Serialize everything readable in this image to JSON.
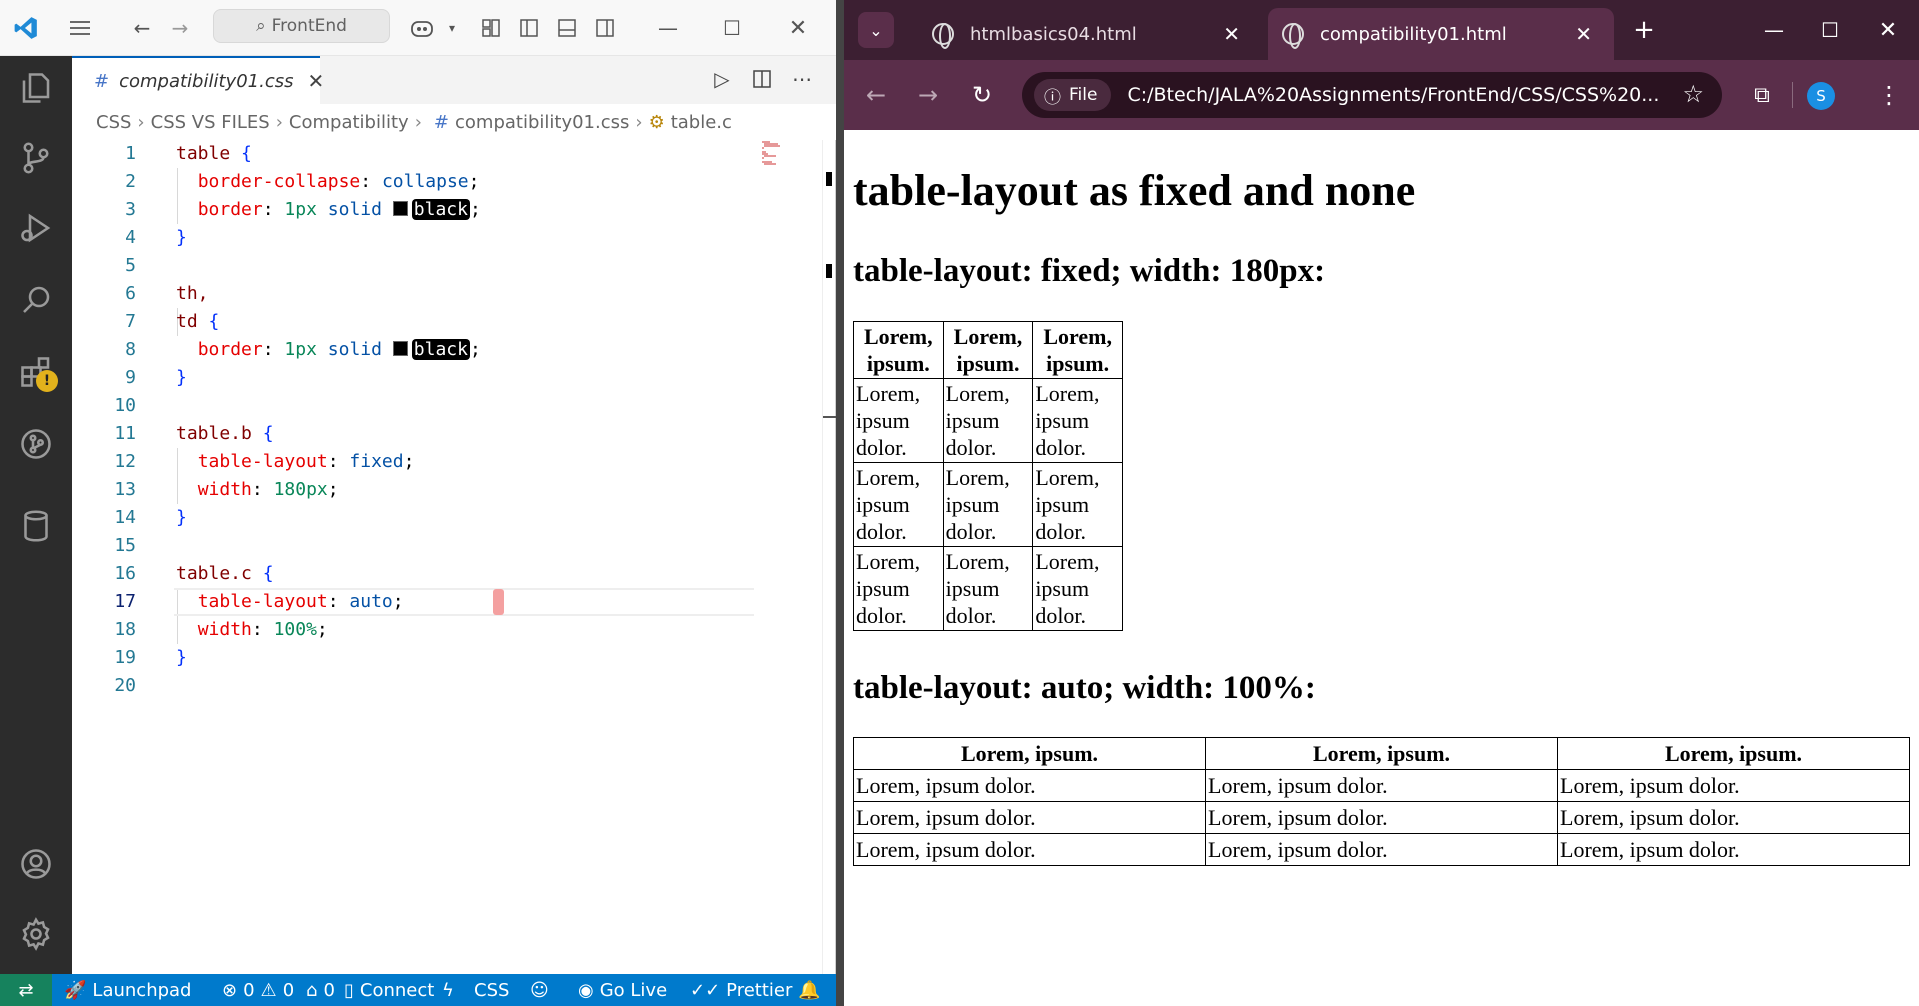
{
  "vscode": {
    "command_center": "FrontEnd",
    "tab": {
      "label": "compatibility01.css",
      "icon": "#"
    },
    "breadcrumb": [
      "CSS",
      "CSS VS FILES",
      "Compatibility",
      "compatibility01.css",
      "table.c"
    ],
    "breadcrumb_file_icon": "#",
    "code_lines": [
      {
        "n": "1"
      },
      {
        "n": "2"
      },
      {
        "n": "3"
      },
      {
        "n": "4"
      },
      {
        "n": "5"
      },
      {
        "n": "6"
      },
      {
        "n": "7"
      },
      {
        "n": "8"
      },
      {
        "n": "9"
      },
      {
        "n": "10"
      },
      {
        "n": "11"
      },
      {
        "n": "12"
      },
      {
        "n": "13"
      },
      {
        "n": "14"
      },
      {
        "n": "15"
      },
      {
        "n": "16"
      },
      {
        "n": "17"
      },
      {
        "n": "18"
      },
      {
        "n": "19"
      },
      {
        "n": "20"
      }
    ],
    "code": {
      "l1_sel": "table",
      "l1_br": "{",
      "l2_prop": "border-collapse",
      "l2_val": "collapse",
      "l3_prop": "border",
      "l3_num": "1px",
      "l3_val": "solid",
      "l3_color": "black",
      "l4_br": "}",
      "l6_sel": "th,",
      "l7_sel": "td",
      "l7_br": "{",
      "l8_prop": "border",
      "l8_num": "1px",
      "l8_val": "solid",
      "l8_color": "black",
      "l9_br": "}",
      "l11_sel": "table.b",
      "l11_br": "{",
      "l12_prop": "table-layout",
      "l12_val": "fixed",
      "l13_prop": "width",
      "l13_num": "180px",
      "l14_br": "}",
      "l16_sel": "table.c",
      "l16_br": "{",
      "l17_prop": "table-layout",
      "l17_val": "auto",
      "l18_prop": "width",
      "l18_num": "100%",
      "l19_br": "}"
    },
    "status": {
      "launchpad": "Launchpad",
      "errors": "0",
      "warnings": "0",
      "ports": "0",
      "connect": "Connect",
      "lang": "CSS",
      "golive": "Go Live",
      "prettier": "Prettier"
    },
    "accent": "#007acc"
  },
  "browser": {
    "tabs": [
      {
        "title": "htmlbasics04.html"
      },
      {
        "title": "compatibility01.html"
      }
    ],
    "chip": "File",
    "url": "C:/Btech/JALA%20Assignments/FrontEnd/CSS/CSS%20...",
    "profile_initial": "S",
    "page": {
      "h1": "table-layout as fixed and none",
      "h2_fixed": "table-layout: fixed; width: 180px:",
      "h2_auto": "table-layout: auto; width: 100%:",
      "table_b": {
        "headers": [
          "Lorem, ipsum.",
          "Lorem, ipsum.",
          "Lorem, ipsum."
        ],
        "rows": [
          [
            "Lorem, ipsum dolor.",
            "Lorem, ipsum dolor.",
            "Lorem, ipsum dolor."
          ],
          [
            "Lorem, ipsum dolor.",
            "Lorem, ipsum dolor.",
            "Lorem, ipsum dolor."
          ],
          [
            "Lorem, ipsum dolor.",
            "Lorem, ipsum dolor.",
            "Lorem, ipsum dolor."
          ]
        ]
      },
      "table_c": {
        "headers": [
          "Lorem, ipsum.",
          "Lorem, ipsum.",
          "Lorem, ipsum."
        ],
        "rows": [
          [
            "Lorem, ipsum dolor.",
            "Lorem, ipsum dolor.",
            "Lorem, ipsum dolor."
          ],
          [
            "Lorem, ipsum dolor.",
            "Lorem, ipsum dolor.",
            "Lorem, ipsum dolor."
          ],
          [
            "Lorem, ipsum dolor.",
            "Lorem, ipsum dolor.",
            "Lorem, ipsum dolor."
          ]
        ]
      }
    },
    "theme_color": "#3c1f32"
  }
}
